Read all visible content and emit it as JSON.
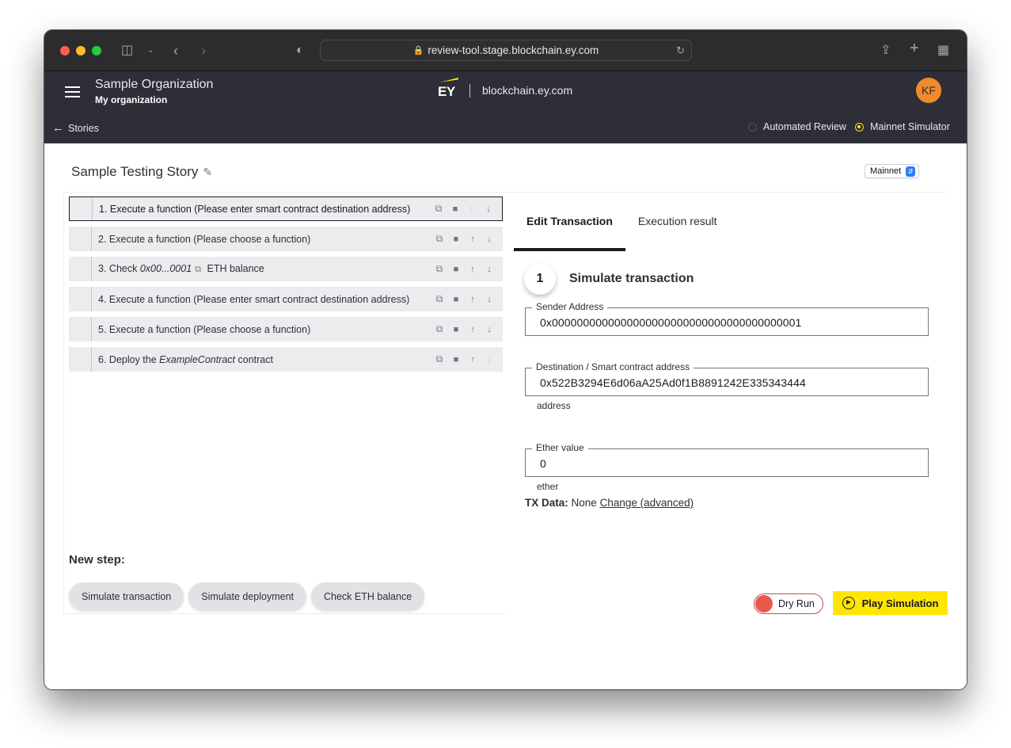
{
  "browser": {
    "url": "review-tool.stage.blockchain.ey.com",
    "icons": [
      "sidebar-toggle-icon",
      "chevron-down-icon",
      "back-icon",
      "forward-icon",
      "shield-icon",
      "lock-icon",
      "reload-icon",
      "share-icon",
      "new-tab-icon",
      "tab-overview-icon"
    ]
  },
  "header": {
    "org_name": "Sample Organization",
    "org_sub": "My organization",
    "logo_text": "EY",
    "domain": "blockchain.ey.com",
    "avatar_initials": "KF",
    "back_label": "Stories",
    "modes": [
      {
        "label": "Automated Review",
        "selected": false
      },
      {
        "label": "Mainnet Simulator",
        "selected": true
      }
    ]
  },
  "story": {
    "title": "Sample Testing Story",
    "network": "Mainnet"
  },
  "steps": [
    {
      "number": "1.",
      "text": "Execute a function (Please enter smart contract destination address)",
      "active": true,
      "up_enabled": false,
      "down_enabled": true
    },
    {
      "number": "2.",
      "text": "Execute a function (Please choose a function)",
      "active": false,
      "up_enabled": true,
      "down_enabled": true
    },
    {
      "number": "3.",
      "pre": "Check ",
      "italic": "0x00...0001",
      "post": " ETH balance",
      "active": false,
      "up_enabled": true,
      "down_enabled": true
    },
    {
      "number": "4.",
      "text": "Execute a function (Please enter smart contract destination address)",
      "active": false,
      "up_enabled": true,
      "down_enabled": true
    },
    {
      "number": "5.",
      "text": "Execute a function (Please choose a function)",
      "active": false,
      "up_enabled": true,
      "down_enabled": true
    },
    {
      "number": "6.",
      "pre": "Deploy the ",
      "italic": "ExampleContract",
      "post": " contract",
      "active": false,
      "up_enabled": true,
      "down_enabled": false
    }
  ],
  "new_step": {
    "title": "New step:",
    "buttons": [
      "Simulate transaction",
      "Simulate deployment",
      "Check ETH balance"
    ]
  },
  "tabs": [
    {
      "label": "Edit Transaction",
      "active": true
    },
    {
      "label": "Execution result",
      "active": false
    }
  ],
  "form": {
    "step_number": "1",
    "heading": "Simulate transaction",
    "sender": {
      "label": "Sender Address",
      "value": "0x0000000000000000000000000000000000000001"
    },
    "destination": {
      "label": "Destination / Smart contract address",
      "value": "0x522B3294E6d06aA25Ad0f1B8891242E335343444",
      "hint": "address"
    },
    "ether": {
      "label": "Ether value",
      "value": "0",
      "hint": "ether"
    },
    "tx_data_label": "TX Data:",
    "tx_data_value": "None",
    "tx_data_link": "Change (advanced)"
  },
  "actions": {
    "dry_run_label": "Dry Run",
    "play_label": "Play Simulation"
  },
  "colors": {
    "header_bg": "#2e2e38",
    "accent_yellow": "#ffe600",
    "avatar": "#f08a2c",
    "dry_run_knob": "#ea574f"
  }
}
